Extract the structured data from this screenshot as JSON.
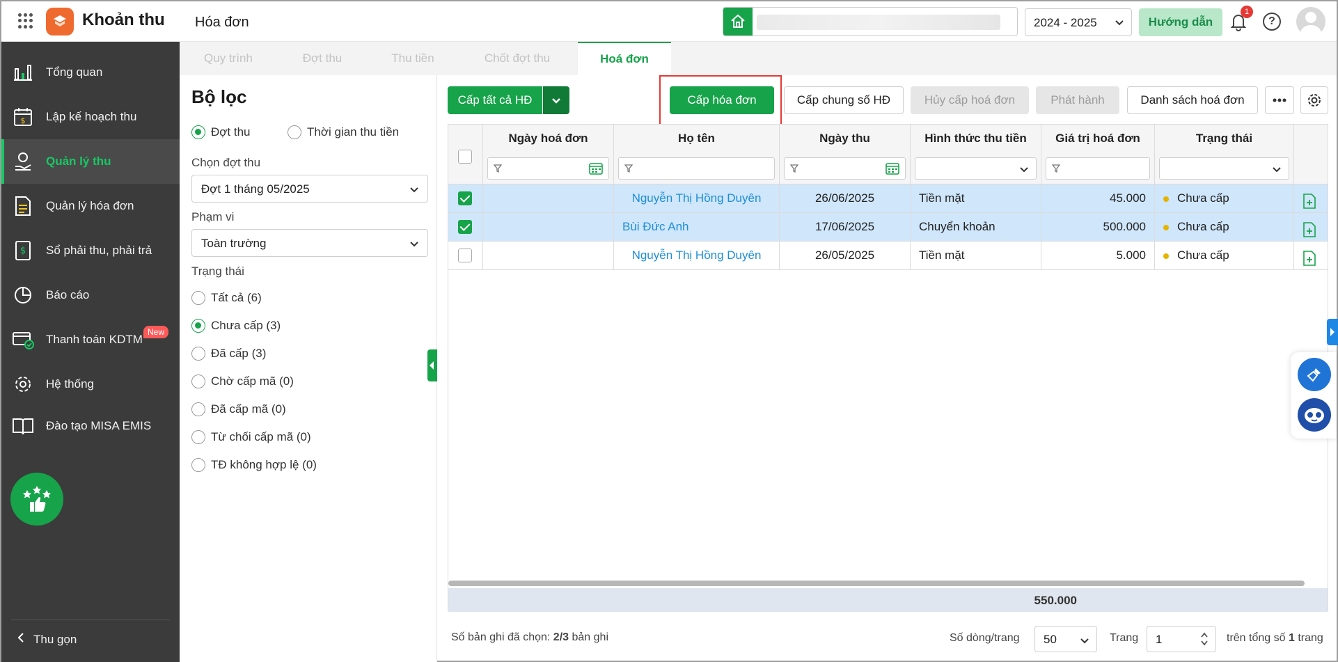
{
  "header": {
    "app_title": "Khoản thu",
    "page_title": "Hóa đơn",
    "school_year": "2024 - 2025",
    "guide_label": "Hướng dẫn",
    "notification_count": "1"
  },
  "sidebar": {
    "items": [
      {
        "label": "Tổng quan",
        "icon": "chart-bars-icon"
      },
      {
        "label": "Lập kế hoạch thu",
        "icon": "calendar-money-icon"
      },
      {
        "label": "Quản lý thu",
        "icon": "coin-hand-icon"
      },
      {
        "label": "Quản lý hóa đơn",
        "icon": "invoice-icon"
      },
      {
        "label": "Sổ phải thu, phải trả",
        "icon": "ledger-icon"
      },
      {
        "label": "Báo cáo",
        "icon": "pie-chart-icon"
      },
      {
        "label": "Thanh toán KDTM",
        "icon": "card-check-icon",
        "badge": "New"
      },
      {
        "label": "Hệ thống",
        "icon": "gear-icon"
      },
      {
        "label": "Đào tạo MISA EMIS",
        "icon": "book-icon"
      }
    ],
    "active_index": 2,
    "collapse_label": "Thu gọn"
  },
  "tabs": [
    "Quy trình",
    "Đợt thu",
    "Thu tiền",
    "Chốt đợt thu",
    "Hoá đơn"
  ],
  "filter": {
    "title": "Bộ lọc",
    "mode_options": [
      "Đợt thu",
      "Thời gian thu tiền"
    ],
    "period_label": "Chọn đợt thu",
    "period_value": "Đợt 1 tháng 05/2025",
    "scope_label": "Phạm vi",
    "scope_value": "Toàn trường",
    "status_label": "Trạng thái",
    "status_options": [
      "Tất cả (6)",
      "Chưa cấp (3)",
      "Đã cấp (3)",
      "Chờ cấp mã (0)",
      "Đã cấp mã (0)",
      "Từ chối cấp mã (0)",
      "TĐ không hợp lệ (0)"
    ]
  },
  "toolbar": {
    "issue_all": "Cấp tất cả HĐ",
    "issue_invoice": "Cấp hóa đơn",
    "issue_shared": "Cấp chung số HĐ",
    "cancel_issue": "Hủy cấp hoá đơn",
    "publish": "Phát hành",
    "invoice_list": "Danh sách hoá đơn"
  },
  "table": {
    "columns": [
      "Ngày hoá đơn",
      "Họ tên",
      "Ngày thu",
      "Hình thức thu tiền",
      "Giá trị hoá đơn",
      "Trạng thái"
    ],
    "rows": [
      {
        "selected": true,
        "invoice_date": "",
        "name": "Nguyễn Thị Hồng Duyên",
        "collect_date": "26/06/2025",
        "method": "Tiền mặt",
        "amount": "45.000",
        "status": "Chưa cấp"
      },
      {
        "selected": true,
        "invoice_date": "",
        "name": "Bùi Đức Anh",
        "collect_date": "17/06/2025",
        "method": "Chuyển khoản",
        "amount": "500.000",
        "status": "Chưa cấp"
      },
      {
        "selected": false,
        "invoice_date": "",
        "name": "Nguyễn Thị Hồng Duyên",
        "collect_date": "26/05/2025",
        "method": "Tiền mặt",
        "amount": "5.000",
        "status": "Chưa cấp"
      }
    ],
    "total": "550.000"
  },
  "footer": {
    "selected_prefix": "Số bản ghi đã chọn:",
    "selected_value": "2/3",
    "selected_suffix": "bản ghi",
    "rows_per_page_label": "Số dòng/trang",
    "rows_per_page": "50",
    "page_label": "Trang",
    "page": "1",
    "total_pages_prefix": "trên tổng số",
    "total_pages": "1",
    "total_pages_suffix": "trang"
  },
  "colors": {
    "primary": "#17a34a",
    "sidebar_bg": "#3b3b3b",
    "link": "#1e8ed8",
    "selected_row": "#cfe6fb",
    "status_dot": "#e5b400",
    "highlight": "#e53935"
  }
}
